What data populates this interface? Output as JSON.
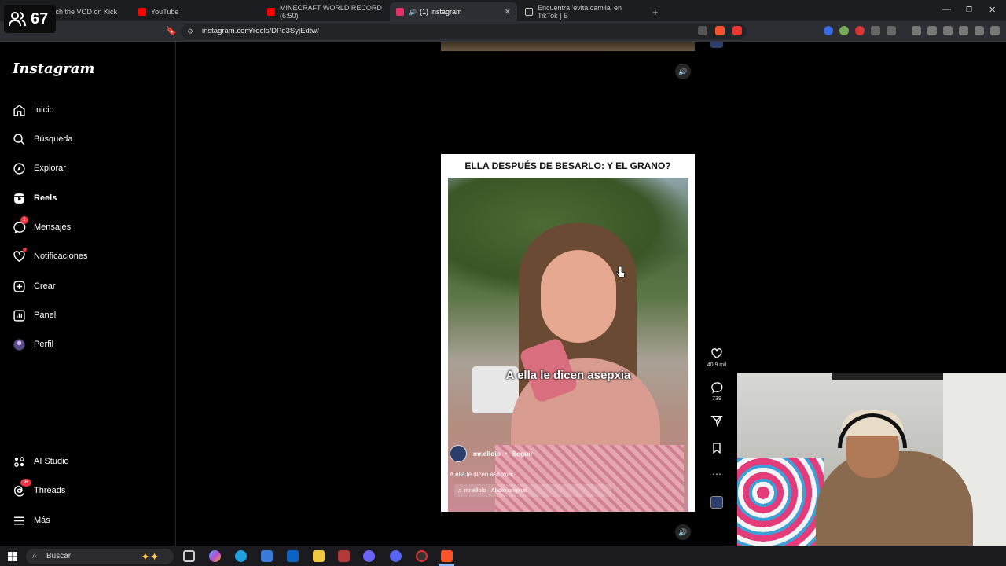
{
  "overlay": {
    "viewer_count": "67"
  },
  "browser": {
    "tabs": [
      {
        "label": "tch the VOD on Kick",
        "color": "#53fc18"
      },
      {
        "label": "YouTube",
        "color": "#ff0000"
      },
      {
        "label": "MINECRAFT WORLD RECORD (6:50)",
        "color": "#ff0000"
      },
      {
        "label": "(1) Instagram",
        "color": "#e1306c",
        "active": true
      },
      {
        "label": "Encuentra 'evita camila' en TikTok | B",
        "color": "#ffffff"
      }
    ],
    "new_tab": "+",
    "url": "instagram.com/reels/DPq3SyjEdtw/"
  },
  "sidebar": {
    "logo": "Instagram",
    "items": [
      {
        "label": "Inicio",
        "icon": "home-icon"
      },
      {
        "label": "Búsqueda",
        "icon": "search-icon"
      },
      {
        "label": "Explorar",
        "icon": "compass-icon"
      },
      {
        "label": "Reels",
        "icon": "reels-icon",
        "active": true
      },
      {
        "label": "Mensajes",
        "icon": "messenger-icon",
        "badge": "1"
      },
      {
        "label": "Notificaciones",
        "icon": "heart-icon"
      },
      {
        "label": "Crear",
        "icon": "plus-square-icon"
      },
      {
        "label": "Panel",
        "icon": "dashboard-icon"
      },
      {
        "label": "Perfil",
        "icon": "avatar-icon"
      }
    ],
    "bottom_items": [
      {
        "label": "AI Studio",
        "icon": "ai-studio-icon"
      },
      {
        "label": "Threads",
        "icon": "threads-icon",
        "badge": "9+"
      },
      {
        "label": "Más",
        "icon": "menu-icon"
      }
    ]
  },
  "reel": {
    "title": "ELLA DESPUÉS DE BESARLO: Y EL GRANO?",
    "overlay_caption": "A ella le dicen asepxia",
    "author": "mr.ellolo",
    "follow": "Seguir",
    "description": "A ella le dicen asepxia",
    "audio": "mr.ellolo · Audio original",
    "likes": "40,9 mil",
    "comments": "739"
  },
  "taskbar": {
    "search_placeholder": "Buscar"
  }
}
